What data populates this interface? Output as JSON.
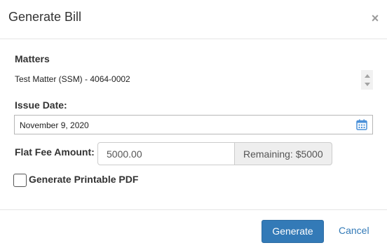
{
  "modal": {
    "title": "Generate Bill",
    "close_icon": "close-icon"
  },
  "matters": {
    "label": "Matters",
    "selected": "Test Matter (SSM) - 4064-0002"
  },
  "issue_date": {
    "label": "Issue Date:",
    "value": "November 9, 2020",
    "icon": "calendar-icon"
  },
  "flat_fee": {
    "label": "Flat Fee Amount:",
    "value": "5000.00",
    "remaining": "Remaining: $5000"
  },
  "printable_pdf": {
    "label": "Generate Printable PDF",
    "checked": false
  },
  "footer": {
    "generate_label": "Generate",
    "cancel_label": "Cancel"
  },
  "colors": {
    "primary": "#337ab7",
    "calendar_icon": "#4a90d9",
    "addon_background": "#eeeeee"
  }
}
